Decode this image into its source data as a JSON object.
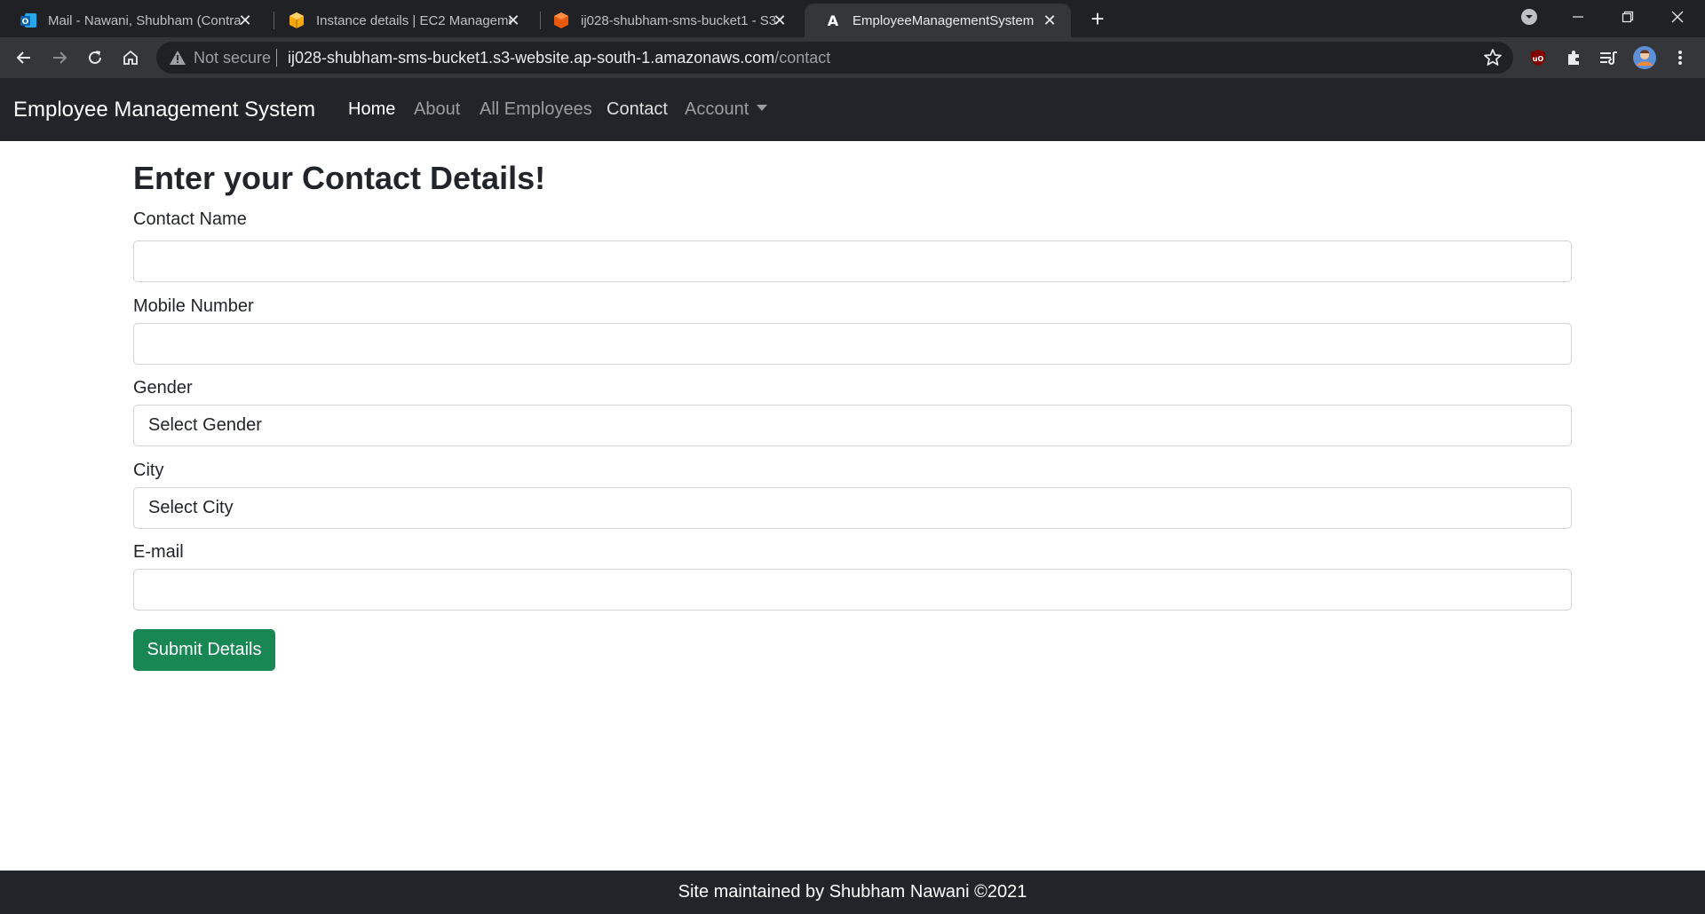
{
  "browser": {
    "tabs": [
      {
        "title": "Mail - Nawani, Shubham (Contra",
        "icon": "outlook-icon"
      },
      {
        "title": "Instance details | EC2 Manageme",
        "icon": "aws-icon"
      },
      {
        "title": "ij028-shubham-sms-bucket1 - S3",
        "icon": "s3-icon"
      },
      {
        "title": "EmployeeManagementSystem",
        "icon": "angular-icon"
      }
    ],
    "security_label": "Not secure",
    "url_host": "ij028-shubham-sms-bucket1.s3-website.ap-south-1.amazonaws.com",
    "url_path": "/contact"
  },
  "navbar": {
    "brand": "Employee Management System",
    "links": [
      "Home",
      "About",
      "All Employees",
      "Contact",
      "Account"
    ]
  },
  "form": {
    "heading": "Enter your Contact Details!",
    "contact_name_label": "Contact Name",
    "contact_name_value": "",
    "mobile_label": "Mobile Number",
    "mobile_value": "",
    "gender_label": "Gender",
    "gender_selected": "Select Gender",
    "city_label": "City",
    "city_selected": "Select City",
    "email_label": "E-mail",
    "email_value": "",
    "submit_label": "Submit Details"
  },
  "footer": {
    "text": "Site maintained by Shubham Nawani ©2021"
  },
  "colors": {
    "navbar_bg": "#212529",
    "submit_bg": "#198754",
    "browser_bg": "#202124"
  }
}
